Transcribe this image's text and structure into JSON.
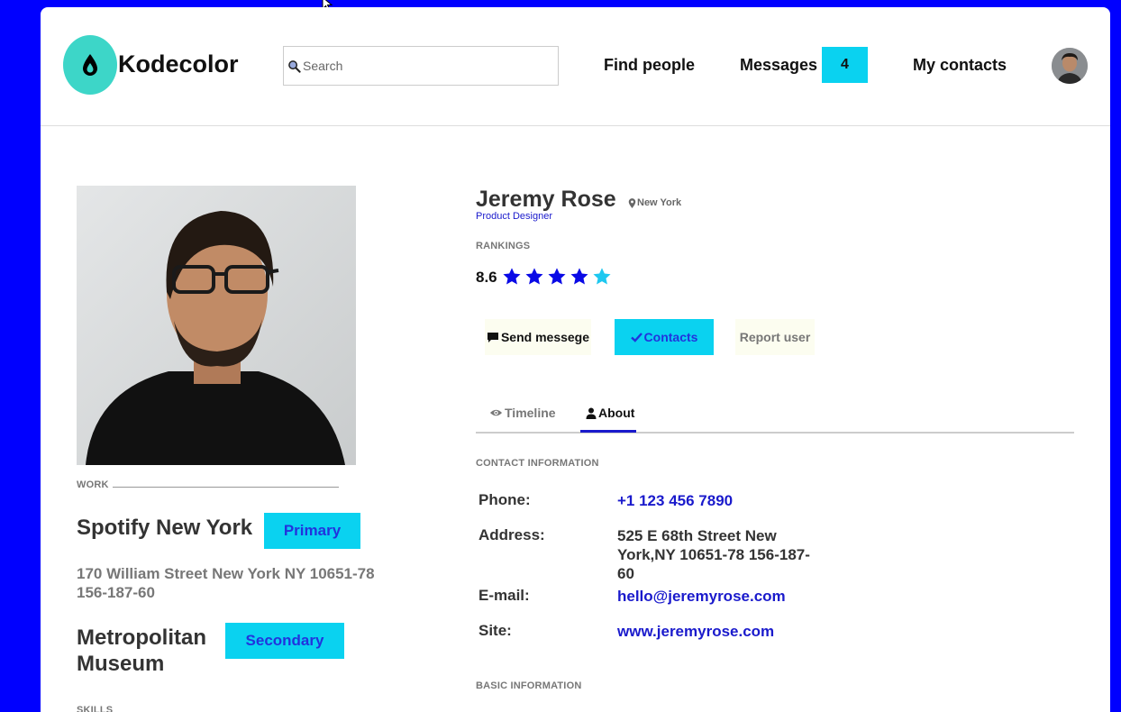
{
  "header": {
    "brand": "Kodecolor",
    "search_placeholder": "Search",
    "nav": {
      "find_people": "Find people",
      "messages": "Messages",
      "messages_count": "4",
      "my_contacts": "My contacts"
    }
  },
  "sidebar": {
    "work_label": "WORK",
    "works": [
      {
        "name": "Spotify New York",
        "tag": "Primary",
        "address": "170 William Street New York NY 10651-78 156-187-60"
      },
      {
        "name": "Metropolitan Museum",
        "tag": "Secondary"
      }
    ],
    "skills_label": "SKILLS"
  },
  "profile": {
    "name": "Jeremy Rose",
    "location": "New York",
    "title": "Product Designer",
    "rankings_label": "RANKINGS",
    "rating": "8.6",
    "stars": 5,
    "star_colors": [
      "#0a0ae6",
      "#0a0ae6",
      "#0a0ae6",
      "#0a0ae6",
      "#1ec8f0"
    ],
    "actions": {
      "send": "Send messege",
      "contacts": "Contacts",
      "report": "Report user"
    },
    "tabs": {
      "timeline": "Timeline",
      "about": "About",
      "active": "About"
    },
    "contact_info_label": "CONTACT INFORMATION",
    "contact": {
      "phone_label": "Phone:",
      "phone": "+1 123 456 7890",
      "address_label": "Address:",
      "address": "525 E 68th Street New York,NY 10651-78 156-187-60",
      "email_label": "E-mail:",
      "email": "hello@jeremyrose.com",
      "site_label": "Site:",
      "site": "www.jeremyrose.com"
    },
    "basic_info_label": "BASIC INFORMATION"
  },
  "colors": {
    "background": "#0000ff",
    "accent": "#0ad2f0",
    "logo": "#3dd6c8",
    "link": "#1a1acc"
  }
}
